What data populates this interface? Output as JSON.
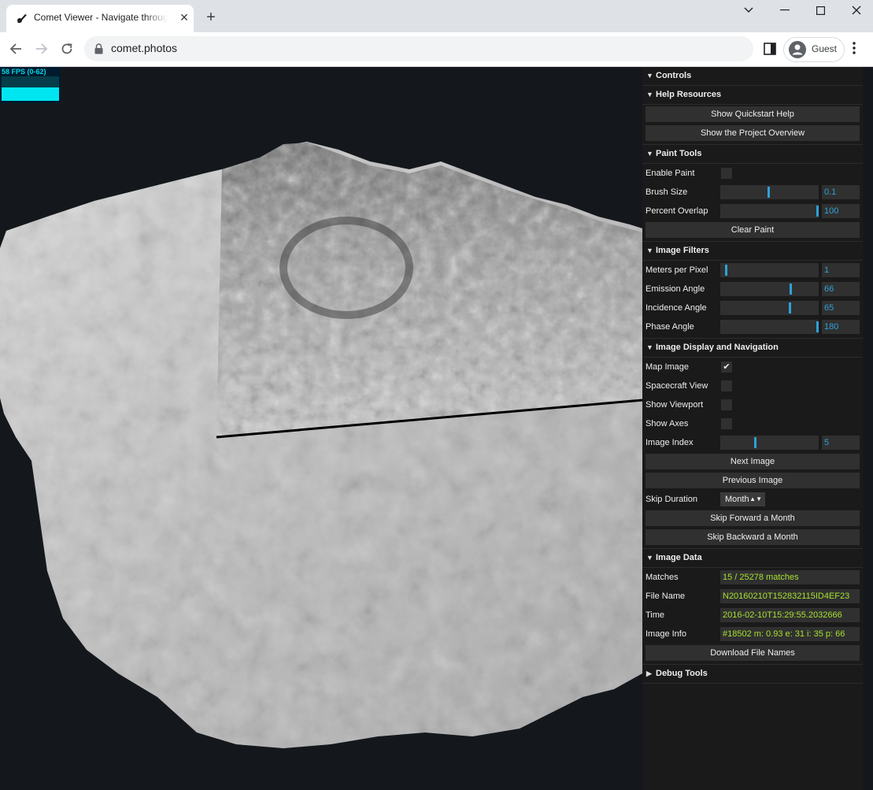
{
  "browser": {
    "tab_title": "Comet Viewer - Navigate through",
    "tab_close": "✕",
    "new_tab": "+",
    "url": "comet.photos",
    "profile_label": "Guest"
  },
  "stats": {
    "fps_label": "58 FPS (0-62)",
    "fps_fraction": 0.55
  },
  "colors": {
    "panel_bg": "#1a1a1a",
    "input_bg": "#303030",
    "number_color": "#2fa1d6",
    "text_value_color": "#a6e22e",
    "viewport_bg": "#14181d"
  },
  "gui": {
    "controls": {
      "title": "Controls"
    },
    "help": {
      "title": "Help Resources",
      "quickstart": "Show Quickstart Help",
      "overview": "Show the Project Overview"
    },
    "paint": {
      "title": "Paint Tools",
      "enable_label": "Enable Paint",
      "brush_label": "Brush Size",
      "brush_value": "0.1",
      "brush_fraction": 0.49,
      "overlap_label": "Percent Overlap",
      "overlap_value": "100",
      "overlap_fraction": 1.0,
      "clear": "Clear Paint"
    },
    "filters": {
      "title": "Image Filters",
      "mpp_label": "Meters per Pixel",
      "mpp_value": "1",
      "mpp_fraction": 0.05,
      "emission_label": "Emission Angle",
      "emission_value": "66",
      "emission_fraction": 0.72,
      "incidence_label": "Incidence Angle",
      "incidence_value": "65",
      "incidence_fraction": 0.71,
      "phase_label": "Phase Angle",
      "phase_value": "180",
      "phase_fraction": 1.0
    },
    "display": {
      "title": "Image Display and Navigation",
      "map_image_label": "Map Image",
      "map_image_check": "✔",
      "spacecraft_label": "Spacecraft View",
      "viewport_label": "Show Viewport",
      "axes_label": "Show Axes",
      "index_label": "Image Index",
      "index_value": "5",
      "index_fraction": 0.35,
      "next": "Next Image",
      "previous": "Previous Image",
      "skip_label": "Skip Duration",
      "skip_value": "Month",
      "skip_forward": "Skip Forward a Month",
      "skip_backward": "Skip Backward a Month"
    },
    "data": {
      "title": "Image Data",
      "matches_label": "Matches",
      "matches_value": "15 / 25278 matches",
      "file_label": "File Name",
      "file_value": "N20160210T152832115ID4EF23",
      "time_label": "Time",
      "time_value": "2016-02-10T15:29:55.2032666",
      "info_label": "Image Info",
      "info_value": "#18502  m: 0.93  e: 31  i: 35  p: 66",
      "download": "Download File Names"
    },
    "debug": {
      "title": "Debug Tools"
    }
  }
}
